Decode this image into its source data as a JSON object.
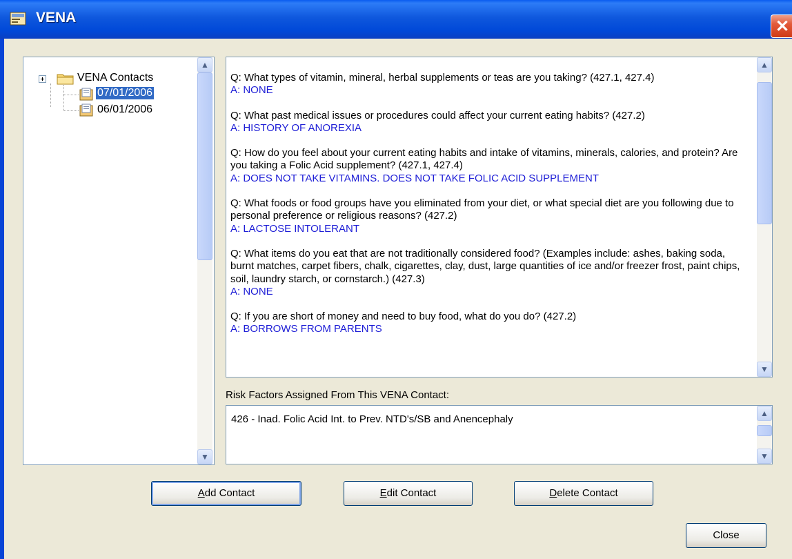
{
  "window": {
    "title": "VENA"
  },
  "tree": {
    "root_label": "VENA Contacts",
    "children": [
      {
        "label": "07/01/2006",
        "selected": true
      },
      {
        "label": "06/01/2006",
        "selected": false
      }
    ]
  },
  "qa": [
    {
      "q": "Q: What types of vitamin, mineral, herbal supplements or teas are you taking? (427.1, 427.4)",
      "a": "A: NONE"
    },
    {
      "q": "Q: What past medical issues or procedures could affect your current eating habits? (427.2)",
      "a": "A: HISTORY OF ANOREXIA"
    },
    {
      "q": "Q: How do you feel about your current eating habits and intake of vitamins, minerals, calories, and protein?  Are you taking a Folic Acid supplement? (427.1, 427.4)",
      "a": "A: DOES NOT TAKE VITAMINS. DOES NOT TAKE FOLIC ACID SUPPLEMENT"
    },
    {
      "q": "Q: What foods or food groups have you eliminated from your diet, or what special diet are you following due to personal preference or religious reasons? (427.2)",
      "a": "A: LACTOSE INTOLERANT"
    },
    {
      "q": "Q: What items do you eat that are not traditionally considered food? (Examples include: ashes, baking soda, burnt matches, carpet fibers, chalk, cigarettes, clay, dust, large quantities of ice and/or freezer frost, paint chips, soil, laundry starch, or cornstarch.) (427.3)",
      "a": "A: NONE"
    },
    {
      "q": "Q: If you are short of money and need to buy food, what do you do? (427.2)",
      "a": "A: BORROWS FROM PARENTS"
    }
  ],
  "risk": {
    "label": "Risk Factors Assigned From This VENA Contact:",
    "item": "426 - Inad. Folic Acid Int. to Prev. NTD's/SB and Anencephaly"
  },
  "buttons": {
    "add_rest": "dd Contact",
    "add_key": "A",
    "edit_rest": "dit Contact",
    "edit_key": "E",
    "delete_rest": "elete Contact",
    "delete_key": "D",
    "close": "Close"
  },
  "icons": {
    "app": "vena-app-icon",
    "close": "close-x-icon",
    "folder": "folder-icon",
    "contact": "contact-doc-icon"
  },
  "colors": {
    "answer": "#1d1dd6",
    "selection": "#316ac5",
    "titlebar": "#0048d8"
  }
}
